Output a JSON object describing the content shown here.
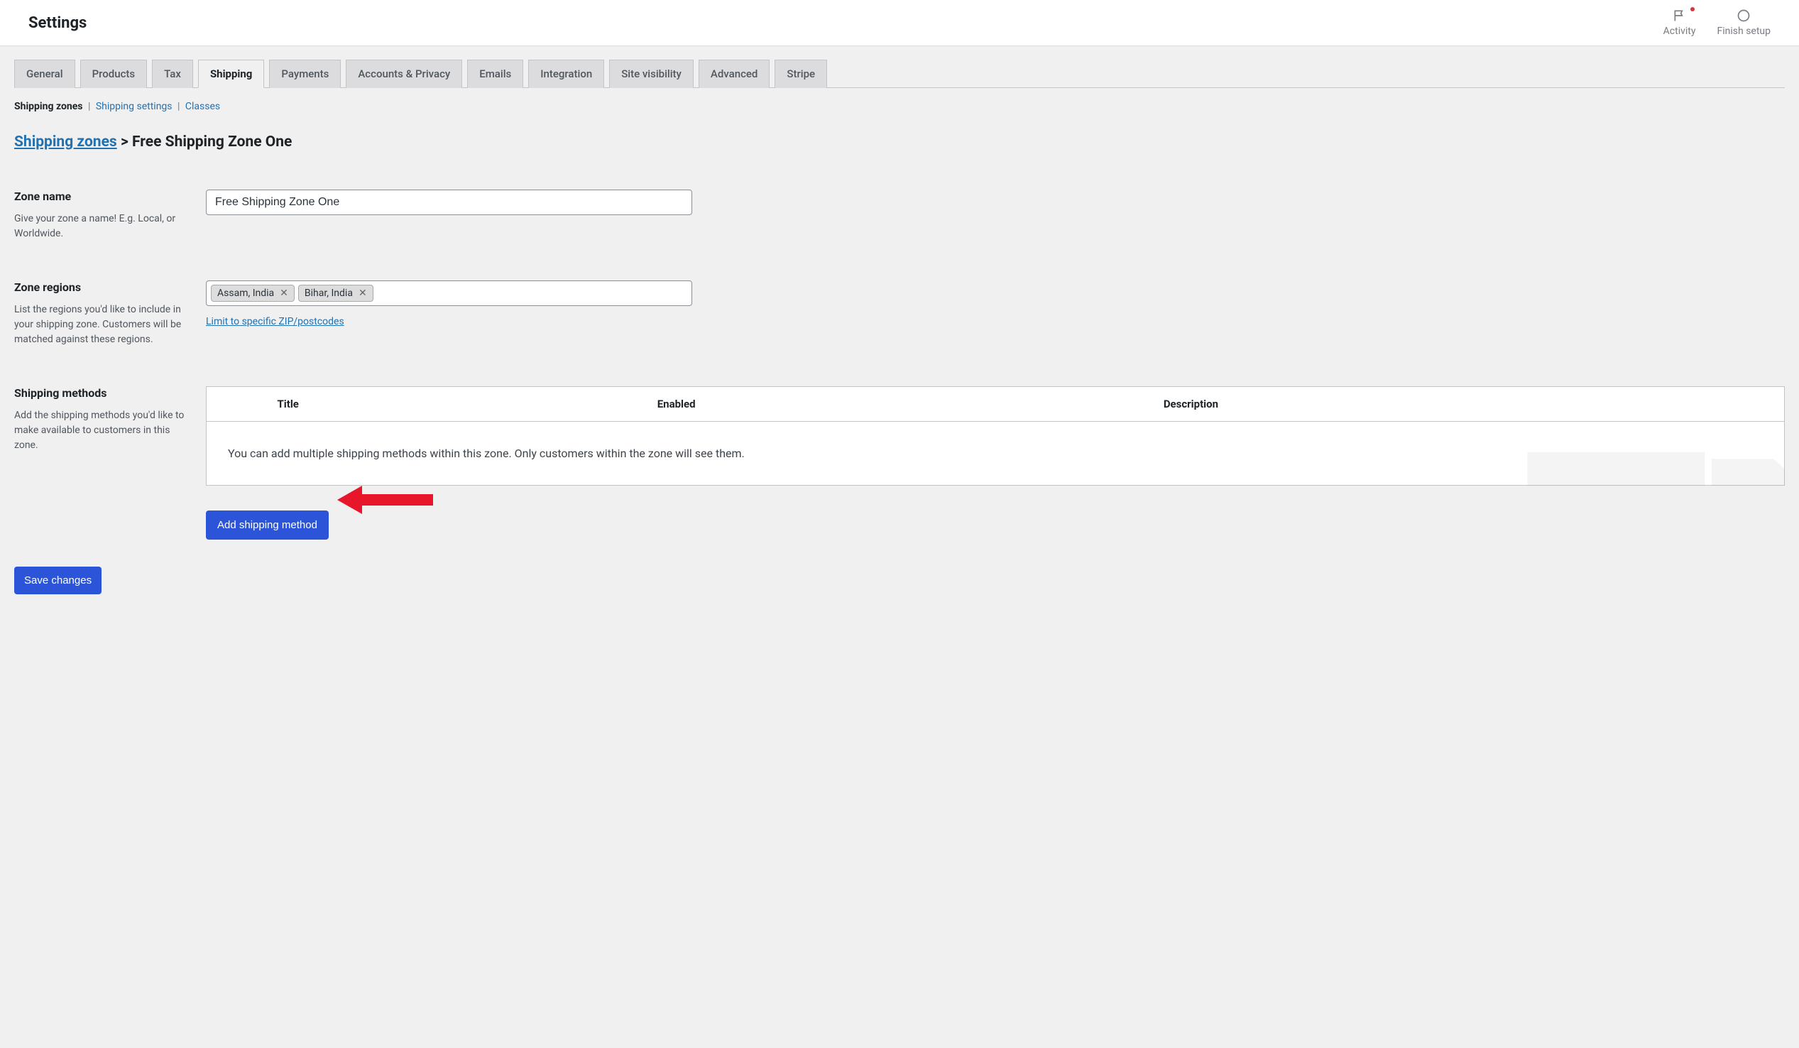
{
  "topbar": {
    "title": "Settings",
    "activity": "Activity",
    "finish_setup": "Finish setup"
  },
  "tabs": [
    {
      "label": "General",
      "active": false
    },
    {
      "label": "Products",
      "active": false
    },
    {
      "label": "Tax",
      "active": false
    },
    {
      "label": "Shipping",
      "active": true
    },
    {
      "label": "Payments",
      "active": false
    },
    {
      "label": "Accounts & Privacy",
      "active": false
    },
    {
      "label": "Emails",
      "active": false
    },
    {
      "label": "Integration",
      "active": false
    },
    {
      "label": "Site visibility",
      "active": false
    },
    {
      "label": "Advanced",
      "active": false
    },
    {
      "label": "Stripe",
      "active": false
    }
  ],
  "subtabs": {
    "zones": "Shipping zones",
    "settings": "Shipping settings",
    "classes": "Classes"
  },
  "breadcrumb": {
    "link_label": "Shipping zones",
    "current": "Free Shipping Zone One"
  },
  "zone_name": {
    "title": "Zone name",
    "desc": "Give your zone a name! E.g. Local, or Worldwide.",
    "value": "Free Shipping Zone One"
  },
  "zone_regions": {
    "title": "Zone regions",
    "desc": "List the regions you'd like to include in your shipping zone. Customers will be matched against these regions.",
    "tags": [
      "Assam, India",
      "Bihar, India"
    ],
    "limit_link": "Limit to specific ZIP/postcodes"
  },
  "shipping_methods": {
    "title": "Shipping methods",
    "desc": "Add the shipping methods you'd like to make available to customers in this zone.",
    "headers": {
      "title": "Title",
      "enabled": "Enabled",
      "description": "Description"
    },
    "empty_text": "You can add multiple shipping methods within this zone. Only customers within the zone will see them.",
    "add_button": "Add shipping method"
  },
  "save_button": "Save changes"
}
